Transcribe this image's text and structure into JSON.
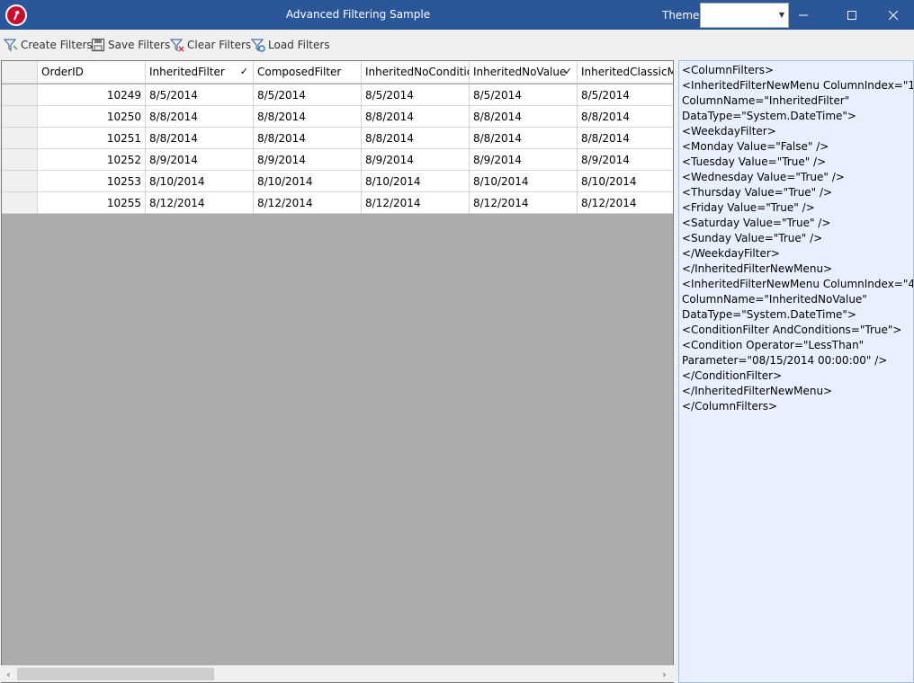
{
  "window": {
    "title": "Advanced Filtering Sample",
    "theme_label": "Theme",
    "theme_value": ""
  },
  "toolbar": {
    "create": "Create Filters",
    "save": "Save Filters",
    "clear": "Clear Filters",
    "load": "Load Filters"
  },
  "grid": {
    "columns": [
      "OrderID",
      "InheritedFilter",
      "ComposedFilter",
      "InheritedNoConditio",
      "InheritedNoValue",
      "InheritedClassicM"
    ],
    "filtered_mark": "✓",
    "rows": [
      [
        "10249",
        "8/5/2014",
        "8/5/2014",
        "8/5/2014",
        "8/5/2014",
        "8/5/2014"
      ],
      [
        "10250",
        "8/8/2014",
        "8/8/2014",
        "8/8/2014",
        "8/8/2014",
        "8/8/2014"
      ],
      [
        "10251",
        "8/8/2014",
        "8/8/2014",
        "8/8/2014",
        "8/8/2014",
        "8/8/2014"
      ],
      [
        "10252",
        "8/9/2014",
        "8/9/2014",
        "8/9/2014",
        "8/9/2014",
        "8/9/2014"
      ],
      [
        "10253",
        "8/10/2014",
        "8/10/2014",
        "8/10/2014",
        "8/10/2014",
        "8/10/2014"
      ],
      [
        "10255",
        "8/12/2014",
        "8/12/2014",
        "8/12/2014",
        "8/12/2014",
        "8/12/2014"
      ]
    ]
  },
  "xml_lines": [
    "<ColumnFilters>",
    "<InheritedFilterNewMenu ColumnIndex=\"1\"",
    "ColumnName=\"InheritedFilter\"",
    "DataType=\"System.DateTime\">",
    "<WeekdayFilter>",
    "<Monday Value=\"False\" />",
    "<Tuesday Value=\"True\" />",
    "<Wednesday Value=\"True\" />",
    "<Thursday Value=\"True\" />",
    "<Friday Value=\"True\" />",
    "<Saturday Value=\"True\" />",
    "<Sunday Value=\"True\" />",
    "</WeekdayFilter>",
    "</InheritedFilterNewMenu>",
    "<InheritedFilterNewMenu ColumnIndex=\"4\"",
    "ColumnName=\"InheritedNoValue\"",
    "DataType=\"System.DateTime\">",
    "<ConditionFilter AndConditions=\"True\">",
    "<Condition Operator=\"LessThan\"",
    "Parameter=\"08/15/2014 00:00:00\" />",
    "</ConditionFilter>",
    "</InheritedFilterNewMenu>",
    "</ColumnFilters>"
  ]
}
